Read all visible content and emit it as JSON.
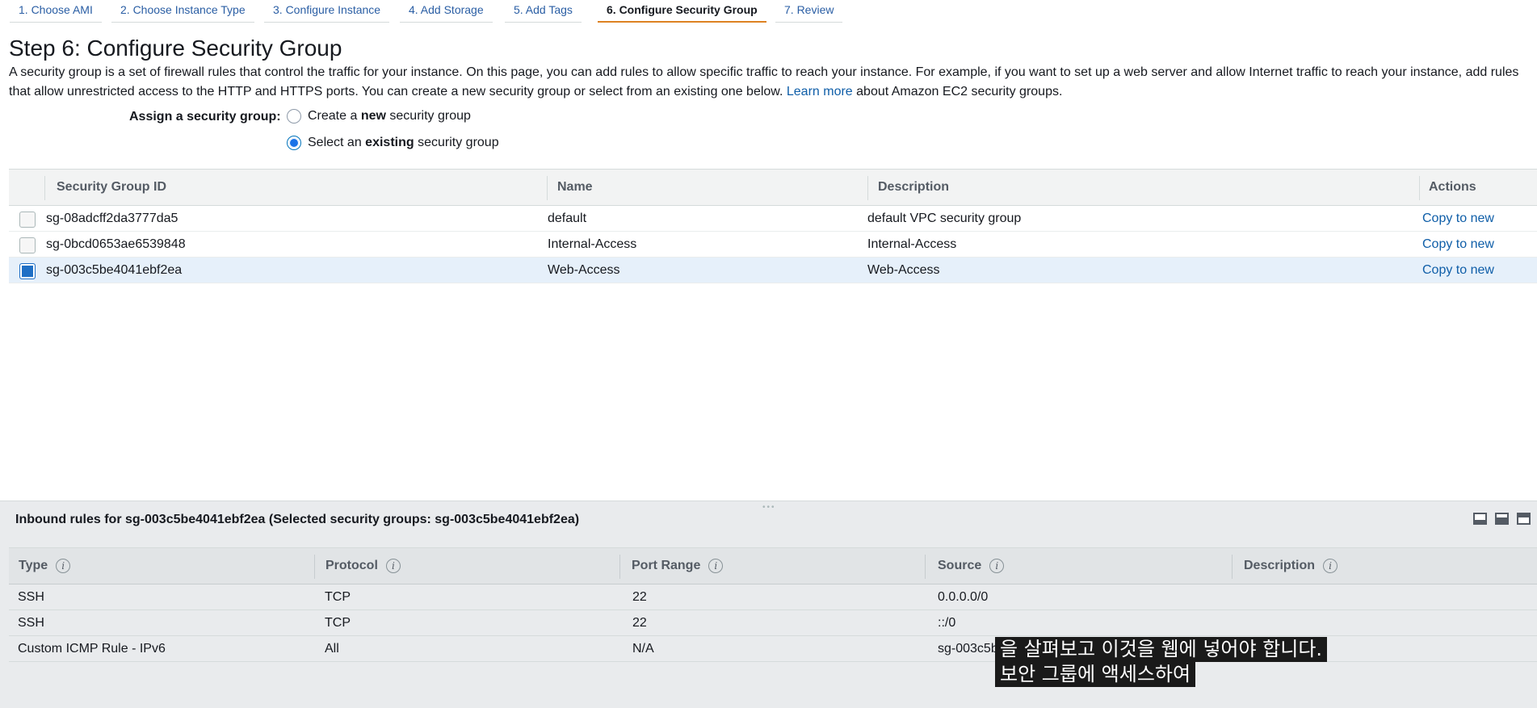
{
  "wizard": {
    "tabs": [
      {
        "label": "1. Choose AMI",
        "active": false
      },
      {
        "label": "2. Choose Instance Type",
        "active": false
      },
      {
        "label": "3. Configure Instance",
        "active": false
      },
      {
        "label": "4. Add Storage",
        "active": false
      },
      {
        "label": "5. Add Tags",
        "active": false
      },
      {
        "label": "6. Configure Security Group",
        "active": true
      },
      {
        "label": "7. Review",
        "active": false
      }
    ]
  },
  "page": {
    "title": "Step 6: Configure Security Group",
    "intro_line1": "A security group is a set of firewall rules that control the traffic for your instance. On this page, you can add rules to allow specific traffic to reach your instance. For example, if you want to set up a web server and allow Internet traffic to reach your instance, add rules",
    "intro_line2_pre": "that allow unrestricted access to the HTTP and HTTPS ports. You can create a new security group or select from an existing one below.",
    "learn_more": "Learn more",
    "intro_line2_post": "about Amazon EC2 security groups."
  },
  "assign": {
    "label": "Assign a security group:",
    "option_new_pre": "Create a",
    "option_new_bold": "new",
    "option_new_post": "security group",
    "option_existing_pre": "Select an",
    "option_existing_bold": "existing",
    "option_existing_post": "security group",
    "selected": "existing"
  },
  "sg_table": {
    "headers": {
      "id": "Security Group ID",
      "name": "Name",
      "description": "Description",
      "actions": "Actions"
    },
    "rows": [
      {
        "id": "sg-08adcff2da3777da5",
        "name": "default",
        "description": "default VPC security group",
        "action": "Copy to new",
        "checked": false
      },
      {
        "id": "sg-0bcd0653ae6539848",
        "name": "Internal-Access",
        "description": "Internal-Access",
        "action": "Copy to new",
        "checked": false
      },
      {
        "id": "sg-003c5be4041ebf2ea",
        "name": "Web-Access",
        "description": "Web-Access",
        "action": "Copy to new",
        "checked": true
      }
    ]
  },
  "inbound": {
    "title": "Inbound rules for sg-003c5be4041ebf2ea (Selected security groups: sg-003c5be4041ebf2ea)",
    "headers": {
      "type": "Type",
      "protocol": "Protocol",
      "port_range": "Port Range",
      "source": "Source",
      "description": "Description"
    },
    "info_glyph": "i",
    "rows": [
      {
        "type": "SSH",
        "protocol": "TCP",
        "port_range": "22",
        "source": "0.0.0.0/0",
        "description": ""
      },
      {
        "type": "SSH",
        "protocol": "TCP",
        "port_range": "22",
        "source": "::/0",
        "description": ""
      },
      {
        "type": "Custom ICMP Rule - IPv6",
        "protocol": "All",
        "port_range": "N/A",
        "source": "sg-003c5b",
        "description": ""
      }
    ]
  },
  "subtitles": {
    "line1": "을 살펴보고 이것을 웹에 넣어야 합니다.",
    "line2": "보안 그룹에 액세스하여"
  }
}
